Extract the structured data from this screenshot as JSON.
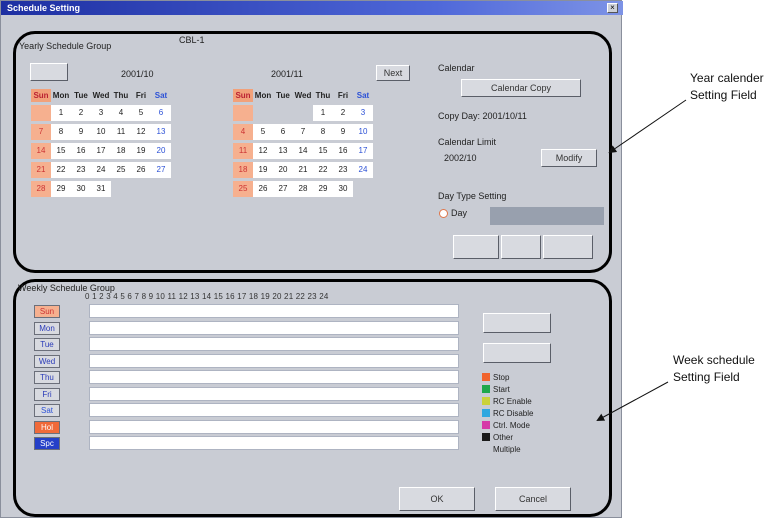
{
  "window": {
    "title": "Schedule Setting",
    "close": "×"
  },
  "yearly": {
    "group_label": "Yearly Schedule Group",
    "block_label": "CBL-1",
    "prev_button": "",
    "next_button": "Next",
    "cal1": {
      "title": "2001/10",
      "headers": [
        "Sun",
        "Mon",
        "Tue",
        "Wed",
        "Thu",
        "Fri",
        "Sat"
      ],
      "rows": [
        [
          "",
          "1",
          "2",
          "3",
          "4",
          "5",
          "6"
        ],
        [
          "7",
          "8",
          "9",
          "10",
          "11",
          "12",
          "13"
        ],
        [
          "14",
          "15",
          "16",
          "17",
          "18",
          "19",
          "20"
        ],
        [
          "21",
          "22",
          "23",
          "24",
          "25",
          "26",
          "27"
        ],
        [
          "28",
          "29",
          "30",
          "31",
          "",
          "",
          ""
        ]
      ]
    },
    "cal2": {
      "title": "2001/11",
      "headers": [
        "Sun",
        "Mon",
        "Tue",
        "Wed",
        "Thu",
        "Fri",
        "Sat"
      ],
      "rows": [
        [
          "",
          "",
          "",
          "",
          "1",
          "2",
          "3"
        ],
        [
          "4",
          "5",
          "6",
          "7",
          "8",
          "9",
          "10"
        ],
        [
          "11",
          "12",
          "13",
          "14",
          "15",
          "16",
          "17"
        ],
        [
          "18",
          "19",
          "20",
          "21",
          "22",
          "23",
          "24"
        ],
        [
          "25",
          "26",
          "27",
          "28",
          "29",
          "30",
          ""
        ]
      ]
    },
    "calendar_label": "Calendar",
    "calendar_copy": "Calendar Copy",
    "copy_day": "Copy Day: 2001/10/11",
    "limit_label": "Calendar Limit",
    "limit_value": "2002/10",
    "modify": "Modify",
    "day_type_label": "Day Type Setting",
    "day_option": "Day"
  },
  "weekly": {
    "group_label": "Weekly Schedule Group",
    "hours": "0 1 2 3 4 5 6 7 8 9 10 11 12 13 14 15 16 17 18 19 20 21 22 23 24",
    "days": [
      "Sun",
      "Mon",
      "Tue",
      "Wed",
      "Thu",
      "Fri",
      "Sat",
      "Hol",
      "Spc"
    ],
    "legend": [
      {
        "label": "Stop",
        "color": "#f0642e"
      },
      {
        "label": "Start",
        "color": "#1fa84a"
      },
      {
        "label": "RC Enable",
        "color": "#cbd23a"
      },
      {
        "label": "RC Disable",
        "color": "#2fa8e0"
      },
      {
        "label": "Ctrl. Mode",
        "color": "#d63aa8"
      },
      {
        "label": "Other",
        "color": "#1a1a1a"
      },
      {
        "label": "Multiple",
        "color": "#c9ccd4"
      }
    ],
    "ok": "OK",
    "cancel": "Cancel"
  },
  "annotations": {
    "year_field": "Year calender\nSetting Field",
    "week_field": "Week schedule\nSetting Field"
  }
}
